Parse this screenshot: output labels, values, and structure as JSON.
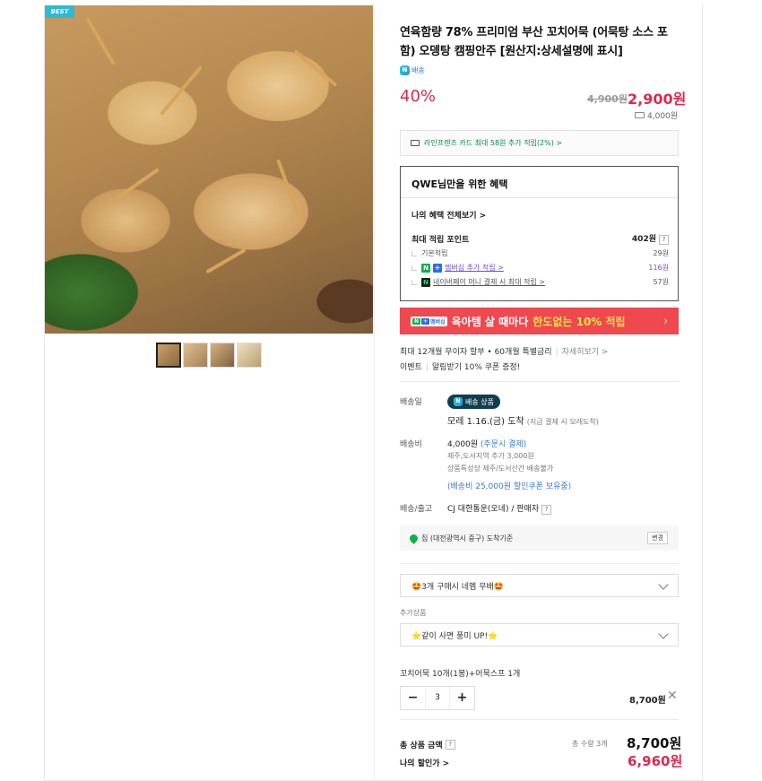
{
  "product": {
    "badge": "BEST",
    "title": "연육함량 78% 프리미엄 부산 꼬치어묵 (어묵탕 소스 포함) 오뎅탕 캠핑안주 [원산지:상세설명에 표시]",
    "delivery_tag": "배송",
    "discount": "40%",
    "original_price": "4,900원",
    "sale_price": "2,900원",
    "shipping_fee": "4,000원"
  },
  "card_offer": "라인프렌즈 카드 최대 58원 추가 적립(2%) >",
  "benefits": {
    "title": "QWE님만을 위한 혜택",
    "view_all": "나의 혜택 전체보기 >",
    "max_label": "최대 적립 포인트",
    "max_value": "402원",
    "basic_label": "기본적립",
    "basic_value": "29원",
    "membership_label": "멤버십 추가 적립 >",
    "membership_value": "116원",
    "naverpay_label": "네이버페이 머니 결제 시 최대 적립 >",
    "naverpay_value": "57원"
  },
  "promo": {
    "badge_n": "N",
    "badge_plus": "+",
    "badge_text": "멤버십",
    "text": "육아템 살 때마다",
    "highlight": "한도없는 10% 적립",
    "arrow": "›"
  },
  "installment": {
    "text": "최대 12개월 무이자 할부 • 60개월 특별금리",
    "link": "자세히보기 >"
  },
  "event": {
    "label": "이벤트",
    "text": "알림받기 10% 쿠폰 증정!"
  },
  "shipping": {
    "date_label": "배송일",
    "pill": "배송 상품",
    "arrival": "모레 1.16.(금) 도착",
    "arrival_note": "(지금 결제 시 모레도착)",
    "fee_label": "배송비",
    "fee": "4,000원",
    "fee_note": "(주문시 결제)",
    "extra1": "제주,도서지역 추가 3,000원",
    "extra2": "상품특성상 제주/도서산간 배송불가",
    "coupon": "(배송비 25,000원 할인쿠폰 보유중)",
    "carrier_label": "배송/출고",
    "carrier": "CJ 대한통운(오네) / 판매자",
    "address": "집 (대전광역시 중구) 도착기준",
    "change": "변경"
  },
  "options": {
    "select1": "🤩3개 구매시 네멤 무배🤩",
    "addon_label": "추가상품",
    "select2": "⭐같이 사면 풍미 UP!⭐",
    "item_name": "꼬치어묵 10개(1봉)+어묵스프 1개",
    "minus": "−",
    "qty": "3",
    "plus": "+",
    "item_price": "8,700원",
    "remove": "✕"
  },
  "totals": {
    "label": "총 상품 금액",
    "count": "총 수량 3개",
    "price": "8,700원",
    "my_label": "나의 할인가 >",
    "my_price": "6,960원"
  },
  "colors": {
    "accent": "#e0284e",
    "promo": "#f0484f",
    "naver_green": "#08b34a",
    "pill": "#113d4e"
  }
}
